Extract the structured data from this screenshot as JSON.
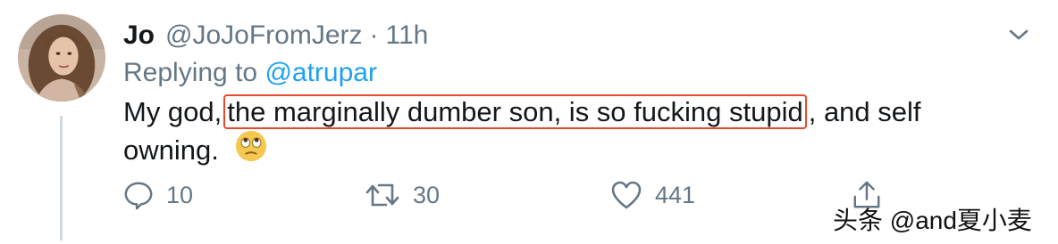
{
  "tweet": {
    "author_name": "Jo",
    "author_handle": "@JoJoFromJerz",
    "separator": "·",
    "time": "11h",
    "reply_prefix": "Replying to",
    "reply_mention": "@atrupar",
    "text_start": "My god,",
    "text_highlight": "the marginally dumber son, is so fucking stupid",
    "text_end": ", and self",
    "text_line2": "owning.",
    "emoji": "face-with-rolling-eyes",
    "reply_count": "10",
    "retweet_count": "30",
    "like_count": "441"
  },
  "watermark": "头条 @and夏小麦",
  "colors": {
    "primary_text": "#14171a",
    "secondary_text": "#657786",
    "link": "#1da1f2",
    "highlight_border": "#e8492c"
  },
  "icons": [
    "avatar-photo",
    "chevron-down-icon",
    "emoji-rolling-eyes-icon",
    "reply-icon",
    "retweet-icon",
    "like-icon",
    "share-icon"
  ]
}
